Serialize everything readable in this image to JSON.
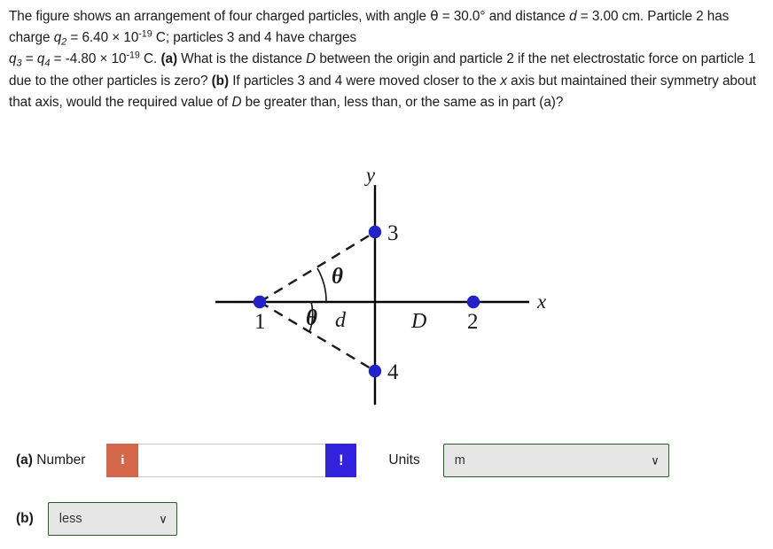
{
  "problem": {
    "line1_a": "The figure shows an arrangement of four charged particles, with angle ",
    "theta_sym": "θ",
    "line1_b": " = 30.0",
    "degree": "°",
    "line1_c": " and distance ",
    "d_sym": "d",
    "line2_a": " = 3.00 cm. Particle 2 has charge ",
    "q_sym": "q",
    "sub2": "2",
    "line2_b": " = 6.40 × 10",
    "exp19": "-19",
    "line2_c": " C; particles 3 and 4 have charges",
    "sub3": "3",
    "line3_eq": " = ",
    "sub4": "4",
    "line3_b": " = -4.80 × 10",
    "line3_c": " C. ",
    "part_a_tag": "(a)",
    "line3_d": " What is the distance ",
    "D_sym": "D",
    "line3_e": " between the origin and particle 2 if the net electrostatic force on particle 1 due to the other particles is zero? ",
    "part_b_tag": "(b)",
    "line4_a": " If particles 3 and 4 were moved closer to the ",
    "x_sym": "x",
    "line4_b": " axis but maintained their symmetry about that axis, would the required value of ",
    "line4_c": " be greater than, less than, or the same as in part (a)?"
  },
  "figure": {
    "axis_label_x": "x",
    "axis_label_y": "y",
    "particle1_label": "1",
    "particle2_label": "2",
    "particle3_label": "3",
    "particle4_label": "4",
    "angle_label_upper": "θ",
    "angle_label_lower": "θ",
    "distance_d_label": "d",
    "distance_D_label": "D",
    "particle_color": "#2222cc",
    "axis_color": "#000000"
  },
  "answers": {
    "a": {
      "part_tag": "(a)",
      "number_label": " Number",
      "info_icon_glyph": "i",
      "warning_icon_glyph": "!",
      "input_value": "",
      "input_placeholder": "",
      "units_label": "Units",
      "units_selected": "m",
      "units_options": [
        "m"
      ],
      "chevron_glyph": "∨",
      "info_color": "#d2674a",
      "warn_color": "#3322dd"
    },
    "b": {
      "part_tag": "(b)",
      "selected": "less",
      "options": [
        "less"
      ],
      "chevron_glyph": "∨"
    }
  }
}
